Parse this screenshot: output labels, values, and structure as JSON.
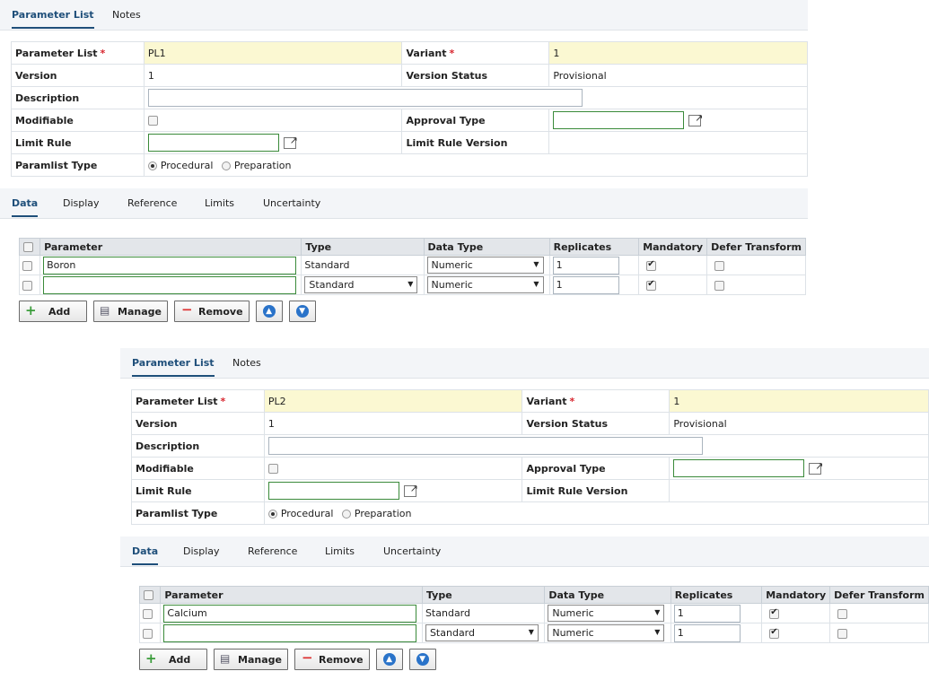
{
  "top_tabs": [
    "Parameter List",
    "Notes"
  ],
  "sub_tabs": [
    "Data",
    "Display",
    "Reference",
    "Limits",
    "Uncertainty"
  ],
  "form_labels": {
    "parameter_list": "Parameter List",
    "variant": "Variant",
    "version": "Version",
    "version_status": "Version Status",
    "description": "Description",
    "modifiable": "Modifiable",
    "approval_type": "Approval Type",
    "limit_rule": "Limit Rule",
    "limit_rule_version": "Limit Rule Version",
    "paramlist_type": "Paramlist Type",
    "required_mark": "*"
  },
  "radio_options": {
    "procedural": "Procedural",
    "preparation": "Preparation"
  },
  "grid_headers": [
    "Parameter",
    "Type",
    "Data Type",
    "Replicates",
    "Mandatory",
    "Defer Transform"
  ],
  "buttons": {
    "add": "Add",
    "manage": "Manage",
    "remove": "Remove"
  },
  "panels": [
    {
      "parameter_list": "PL1",
      "variant": "1",
      "version": "1",
      "version_status": "Provisional",
      "rows": [
        {
          "parameter": "Boron",
          "type": "Standard",
          "type_editable": false,
          "data_type": "Numeric",
          "replicates": "1"
        },
        {
          "parameter": "",
          "type": "Standard",
          "type_editable": true,
          "data_type": "Numeric",
          "replicates": "1"
        }
      ]
    },
    {
      "parameter_list": "PL2",
      "variant": "1",
      "version": "1",
      "version_status": "Provisional",
      "rows": [
        {
          "parameter": "Calcium",
          "type": "Standard",
          "type_editable": false,
          "data_type": "Numeric",
          "replicates": "1"
        },
        {
          "parameter": "",
          "type": "Standard",
          "type_editable": true,
          "data_type": "Numeric",
          "replicates": "1"
        }
      ]
    }
  ]
}
